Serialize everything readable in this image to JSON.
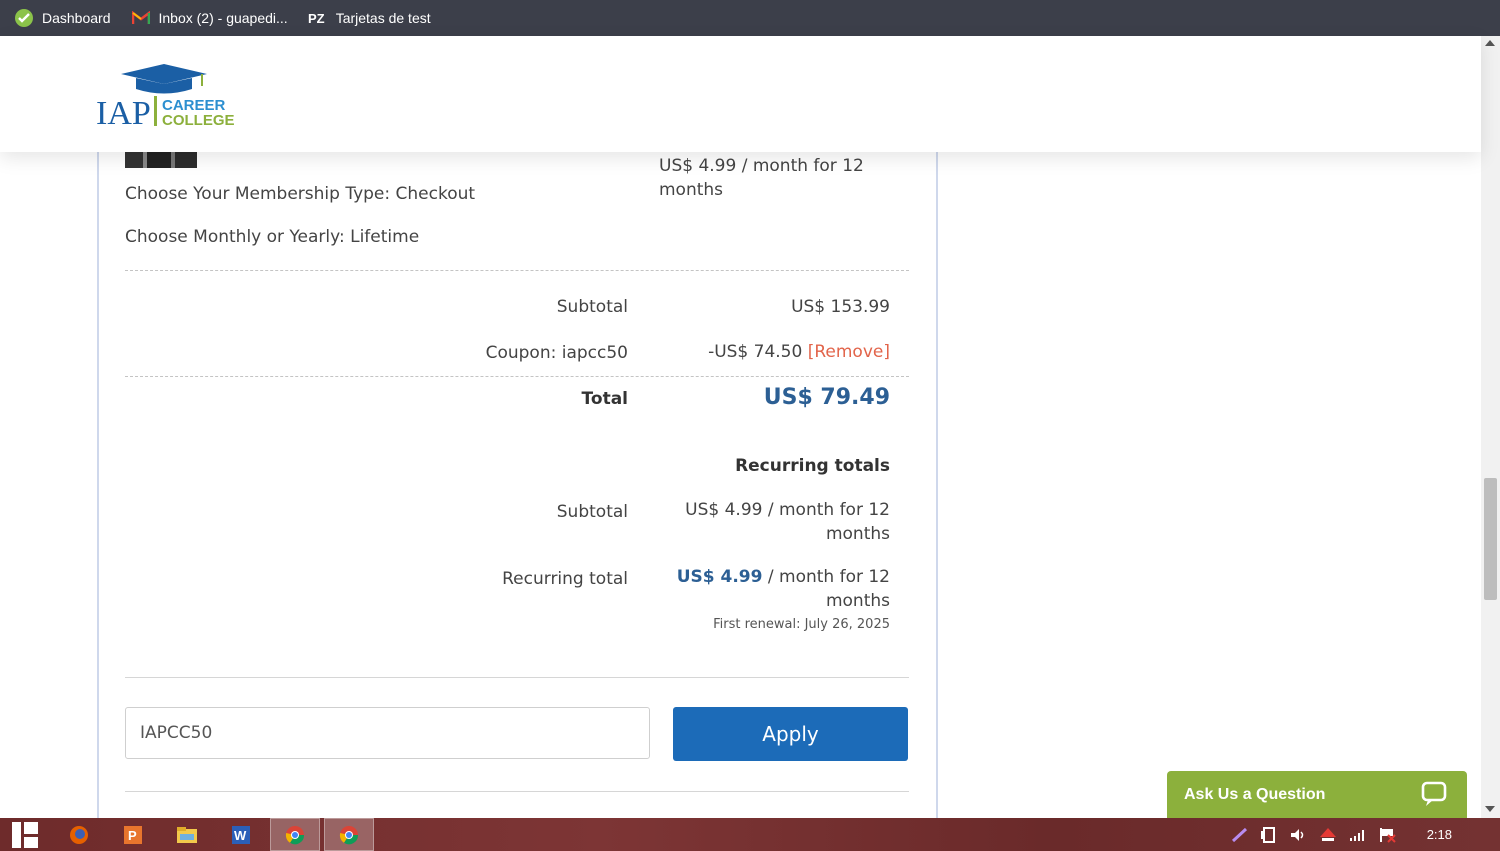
{
  "bookmarks": [
    {
      "label": "Dashboard",
      "icon": "dashboard-check-icon"
    },
    {
      "label": "Inbox (2) - guapedi...",
      "icon": "gmail-icon"
    },
    {
      "label": "Tarjetas de test",
      "icon": "pz-icon"
    }
  ],
  "logo": {
    "iap": "IAP",
    "career": "CAREER",
    "college": "COLLEGE"
  },
  "order": {
    "membership_type": "Choose Your Membership Type: Checkout",
    "monthly_yearly": "Choose Monthly or Yearly: Lifetime",
    "item_price": "US$ 4.99 / month for 12",
    "item_price_2": "months",
    "subtotal_label": "Subtotal",
    "subtotal_value": "US$ 153.99",
    "coupon_label": "Coupon: iapcc50",
    "coupon_value": "-US$ 74.50",
    "coupon_remove": "[Remove]",
    "total_label": "Total",
    "total_value": "US$ 79.49"
  },
  "recurring": {
    "heading": "Recurring totals",
    "subtotal_label": "Subtotal",
    "subtotal_value_1": "US$ 4.99 / month for 12",
    "subtotal_value_2": "months",
    "total_label": "Recurring total",
    "total_amount": "US$ 4.99",
    "total_rest": " / month for 12",
    "total_value_2": "months",
    "first_renewal": "First renewal: July 26, 2025"
  },
  "coupon": {
    "input_value": "IAPCC50",
    "apply_label": "Apply"
  },
  "chat": {
    "label": "Ask Us a Question"
  },
  "taskbar": {
    "time": "2:18"
  },
  "colors": {
    "accent_blue": "#1c6bb8",
    "total_blue": "#2c5f94",
    "remove_red": "#e2644a",
    "chat_green": "#8cb03c"
  }
}
